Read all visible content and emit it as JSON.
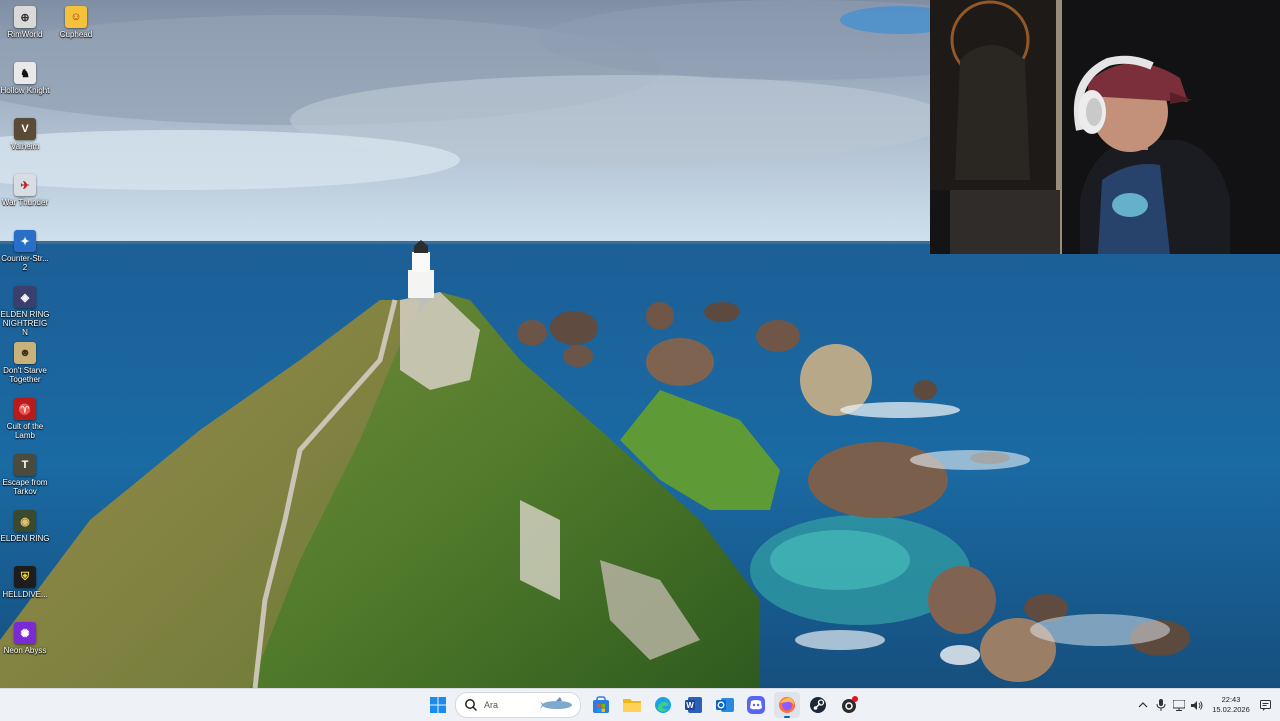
{
  "desktop": {
    "icons": [
      {
        "label": "RimWorld",
        "icon": "rimworld-icon"
      },
      {
        "label": "Cuphead",
        "icon": "cuphead-icon"
      },
      {
        "label": "Hollow Knight",
        "icon": "hollow-knight-icon"
      },
      {
        "label": "Valheim",
        "icon": "valheim-icon"
      },
      {
        "label": "War Thunder",
        "icon": "war-thunder-icon"
      },
      {
        "label": "Counter-Str... 2",
        "icon": "counter-strike-icon"
      },
      {
        "label": "ELDEN RING NIGHTREIGN",
        "icon": "elden-ring-nightreign-icon"
      },
      {
        "label": "Don't Starve Together",
        "icon": "dont-starve-icon"
      },
      {
        "label": "Cult of the Lamb",
        "icon": "cult-of-the-lamb-icon"
      },
      {
        "label": "Escape from Tarkov",
        "icon": "tarkov-icon"
      },
      {
        "label": "ELDEN RING",
        "icon": "elden-ring-icon"
      },
      {
        "label": "HELLDIVE...",
        "icon": "helldivers-icon"
      },
      {
        "label": "Neon Abyss",
        "icon": "neon-abyss-icon"
      }
    ]
  },
  "taskbar": {
    "search_placeholder": "Ara",
    "pinned": [
      "start-icon",
      "search-icon",
      "widgets-icon",
      "microsoft-store-icon",
      "file-explorer-icon",
      "edge-icon",
      "word-icon",
      "outlook-icon",
      "discord-icon",
      "firefox-icon",
      "steam-icon",
      "recording-app-icon"
    ],
    "clock": {
      "time": "22:43",
      "date": "15.02.2026"
    }
  },
  "colors": {
    "taskbar_bg": "#eef1f5",
    "accent": "#0067c0"
  }
}
